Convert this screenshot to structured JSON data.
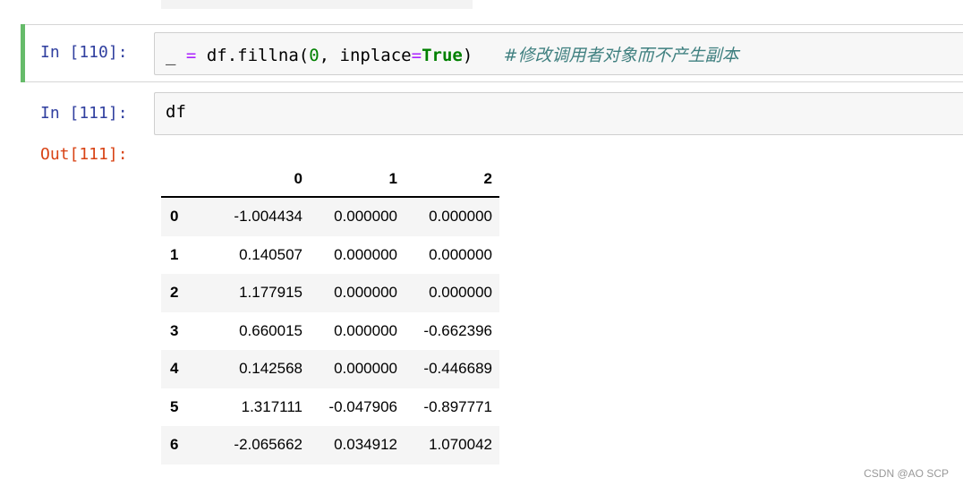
{
  "cells": [
    {
      "prompt": "In [110]:",
      "code": {
        "underscore": "_",
        "equals": "=",
        "call_prefix": "df.fillna(",
        "arg_zero": "0",
        "arg_sep": ", inplace",
        "kw_equals": "=",
        "kw_true": "True",
        "close": ")",
        "comment": "#修改调用者对象而不产生副本"
      }
    },
    {
      "prompt": "In [111]:",
      "code": {
        "text": "df"
      },
      "out_prompt": "Out[111]:"
    }
  ],
  "dataframe": {
    "columns": [
      "0",
      "1",
      "2"
    ],
    "rows": [
      {
        "index": "0",
        "values": [
          "-1.004434",
          "0.000000",
          "0.000000"
        ]
      },
      {
        "index": "1",
        "values": [
          "0.140507",
          "0.000000",
          "0.000000"
        ]
      },
      {
        "index": "2",
        "values": [
          "1.177915",
          "0.000000",
          "0.000000"
        ]
      },
      {
        "index": "3",
        "values": [
          "0.660015",
          "0.000000",
          "-0.662396"
        ]
      },
      {
        "index": "4",
        "values": [
          "0.142568",
          "0.000000",
          "-0.446689"
        ]
      },
      {
        "index": "5",
        "values": [
          "1.317111",
          "-0.047906",
          "-0.897771"
        ]
      },
      {
        "index": "6",
        "values": [
          "-2.065662",
          "0.034912",
          "1.070042"
        ]
      }
    ]
  },
  "watermark": "CSDN @AO SCP",
  "colors": {
    "selected_bar": "#66bb6a",
    "in_prompt": "#303f9f",
    "out_prompt": "#d84315",
    "keyword_true": "#008000",
    "comment": "#408080"
  }
}
